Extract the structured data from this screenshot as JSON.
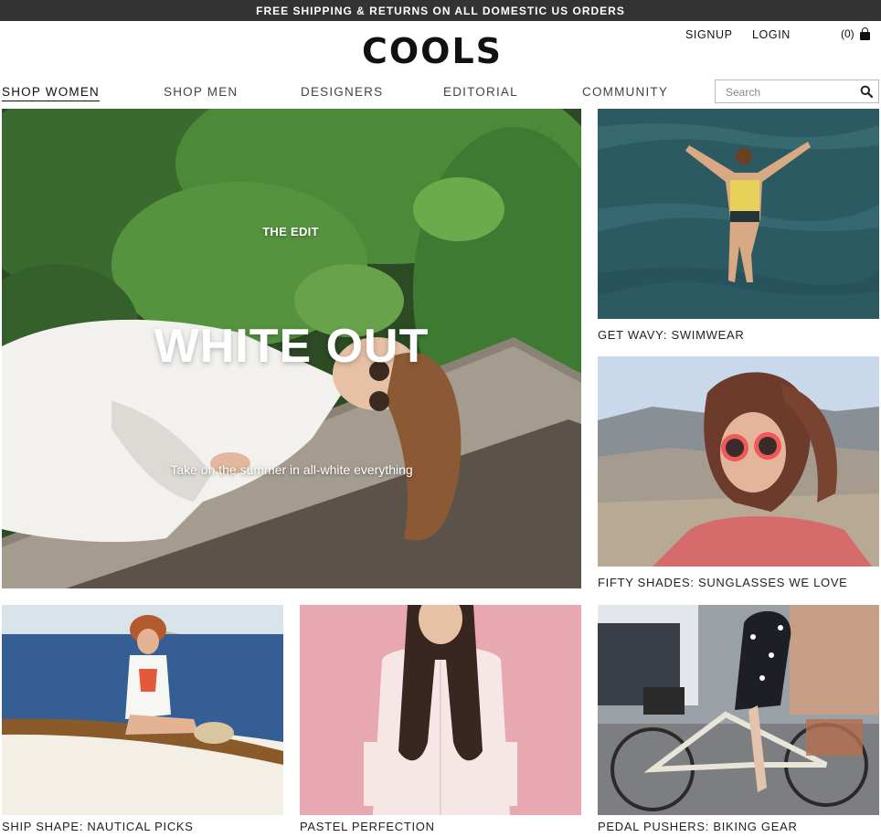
{
  "promo": {
    "text": "FREE SHIPPING & RETURNS ON ALL DOMESTIC US ORDERS"
  },
  "header": {
    "logo": "COOLS",
    "signup": "SIGNUP",
    "login": "LOGIN",
    "cart_count": "(0)"
  },
  "nav": {
    "items": [
      {
        "label": "SHOP WOMEN",
        "active": true
      },
      {
        "label": "SHOP MEN"
      },
      {
        "label": "DESIGNERS"
      },
      {
        "label": "EDITORIAL"
      },
      {
        "label": "COMMUNITY"
      }
    ]
  },
  "search": {
    "placeholder": "Search",
    "value": ""
  },
  "hero": {
    "kicker": "THE EDIT",
    "title": "WHITE OUT",
    "subtitle": "Take on the summer in all-white everything"
  },
  "tiles": [
    {
      "caption": "GET WAVY: SWIMWEAR"
    },
    {
      "caption": "FIFTY SHADES: SUNGLASSES WE LOVE"
    },
    {
      "caption": "SHIP SHAPE: NAUTICAL PICKS"
    },
    {
      "caption": "PASTEL PERFECTION"
    },
    {
      "caption": "PEDAL PUSHERS: BIKING GEAR"
    }
  ],
  "colors": {
    "promo_bar": "#333333",
    "text": "#222222",
    "foliage": "#3f7a33",
    "water": "#2f5f66",
    "pastel_pink": "#e8a8b2"
  }
}
